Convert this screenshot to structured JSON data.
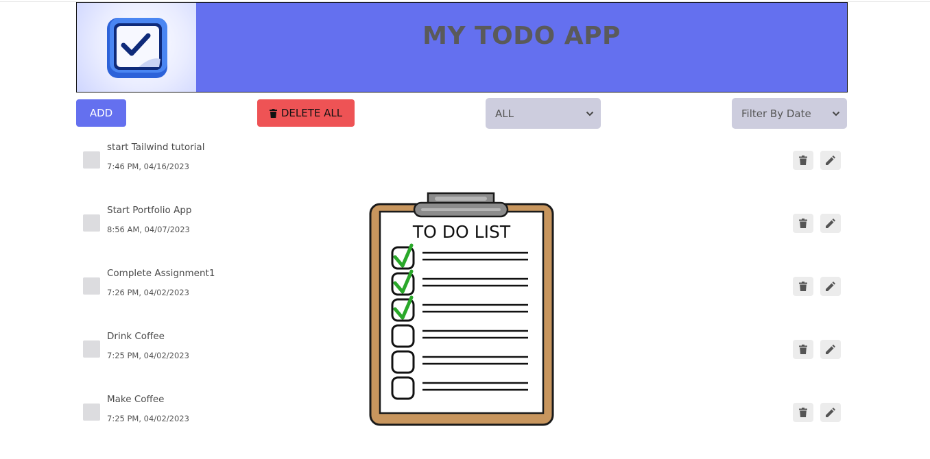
{
  "header": {
    "title": "MY TODO APP"
  },
  "toolbar": {
    "add_label": "ADD",
    "delete_all_label": "DELETE ALL",
    "status_filter": "ALL",
    "date_filter": "Filter By Date"
  },
  "illustration": {
    "heading": "TO DO LIST",
    "checked_boxes": 3,
    "total_boxes": 6
  },
  "todos": [
    {
      "title": "start Tailwind tutorial",
      "time": "7:46 PM, 04/16/2023"
    },
    {
      "title": "Start Portfolio App",
      "time": "8:56 AM, 04/07/2023"
    },
    {
      "title": "Complete Assignment1",
      "time": "7:26 PM, 04/02/2023"
    },
    {
      "title": "Drink Coffee",
      "time": "7:25 PM, 04/02/2023"
    },
    {
      "title": "Make Coffee",
      "time": "7:25 PM, 04/02/2023"
    }
  ],
  "colors": {
    "accent": "#6470ef",
    "danger": "#ee5355",
    "select_bg": "#cdcdde",
    "clipboard": "#c8965e"
  }
}
